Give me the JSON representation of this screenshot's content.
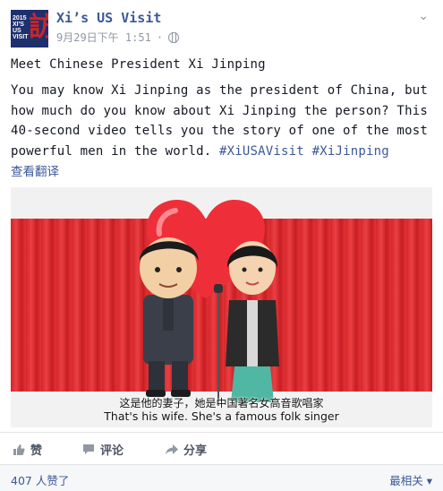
{
  "post": {
    "page_name": "Xi’s US Visit",
    "avatar_abbr": "2015 XI'S US VISIT",
    "avatar_mark": "訪",
    "timestamp": "9月29日下午 1:51",
    "separator": "·",
    "headline": "Meet Chinese President Xi Jinping",
    "body": "You may know Xi Jinping as the president of China, but how much do you know about Xi Jinping the person? This 40-second video tells you the story of one of the most powerful men in the world.",
    "hashtags": [
      "#XiUSAVisit",
      "#XiJinping"
    ],
    "translate_link": "查看翻译"
  },
  "video": {
    "subtitle_zh": "这是他的妻子，她是中国著名女高音歌唱家",
    "subtitle_en": "That's his wife. She's a famous folk singer"
  },
  "actions": {
    "like": "赞",
    "comment": "评论",
    "share": "分享"
  },
  "footer": {
    "likes_text": "407 人赞了",
    "sort_label": "最相关",
    "sort_caret": "▾"
  },
  "colors": {
    "brand": "#3b5998",
    "curtain": "#d8262a",
    "meta": "#9197a3"
  }
}
